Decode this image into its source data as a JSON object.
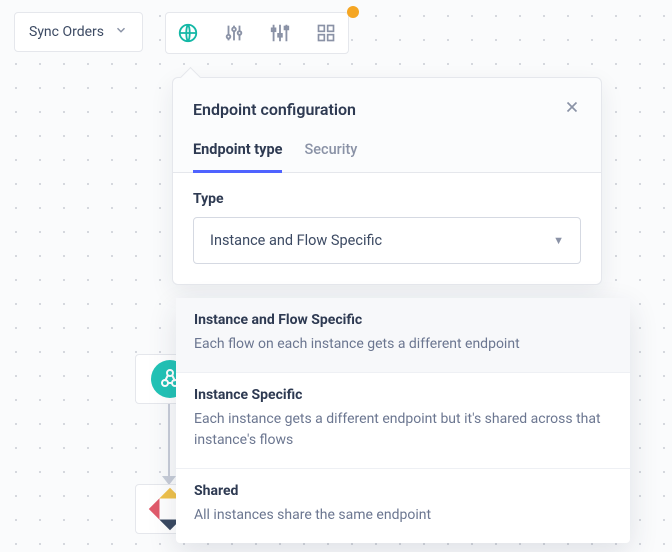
{
  "chip": {
    "label": "Sync Orders"
  },
  "toolbar": {
    "items": [
      "globe",
      "sliders-vertical",
      "sliders-horizontal",
      "grid"
    ]
  },
  "panel": {
    "title": "Endpoint configuration",
    "tabs": [
      {
        "label": "Endpoint type",
        "active": true
      },
      {
        "label": "Security",
        "active": false
      }
    ],
    "field_label": "Type",
    "select_value": "Instance and Flow Specific"
  },
  "dropdown": {
    "options": [
      {
        "title": "Instance and Flow Specific",
        "desc": "Each flow on each instance gets a different endpoint"
      },
      {
        "title": "Instance Specific",
        "desc": "Each instance gets a different endpoint but it's shared across that instance's flows"
      },
      {
        "title": "Shared",
        "desc": "All instances share the same endpoint"
      }
    ]
  }
}
